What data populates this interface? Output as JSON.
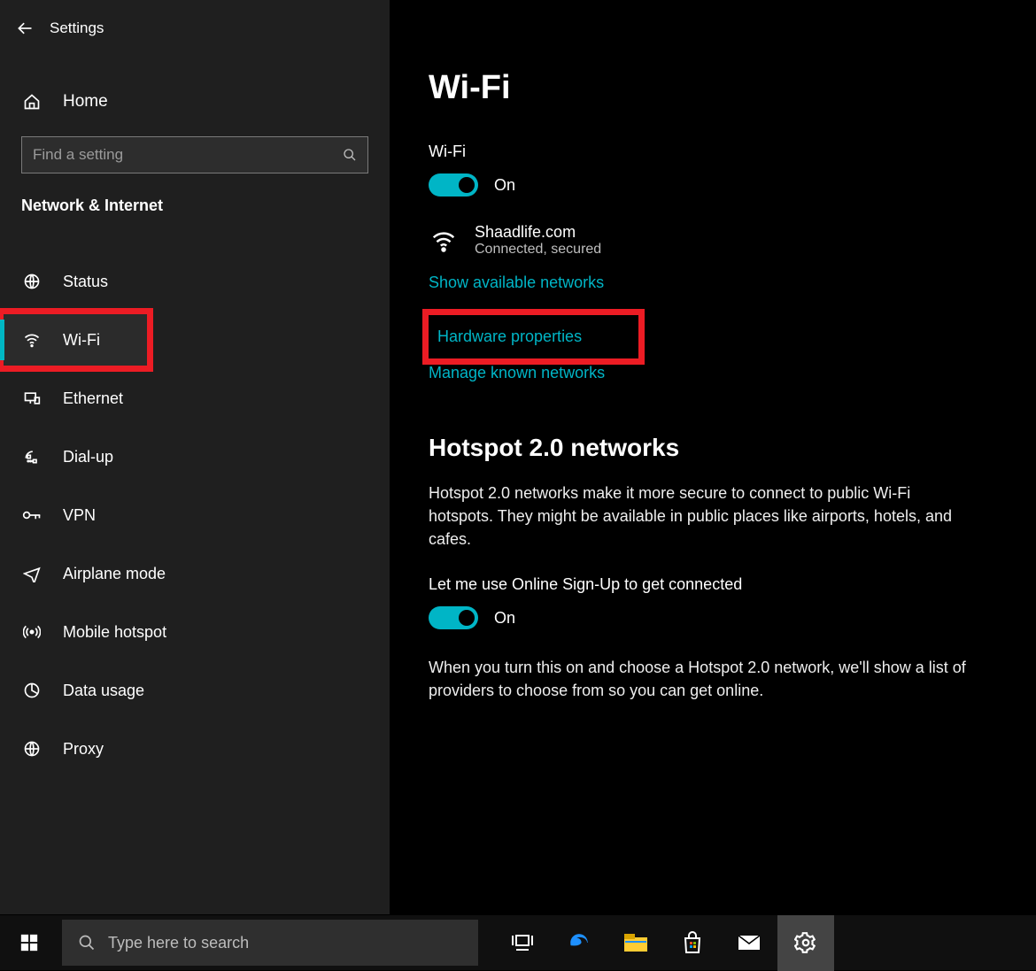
{
  "titlebar": {
    "title": "Settings"
  },
  "home": {
    "label": "Home"
  },
  "search": {
    "placeholder": "Find a setting"
  },
  "section": {
    "label": "Network & Internet"
  },
  "nav": {
    "items": [
      {
        "label": "Status",
        "icon": "globe-icon"
      },
      {
        "label": "Wi-Fi",
        "icon": "wifi-icon"
      },
      {
        "label": "Ethernet",
        "icon": "ethernet-icon"
      },
      {
        "label": "Dial-up",
        "icon": "dialup-icon"
      },
      {
        "label": "VPN",
        "icon": "vpn-icon"
      },
      {
        "label": "Airplane mode",
        "icon": "airplane-icon"
      },
      {
        "label": "Mobile hotspot",
        "icon": "hotspot-icon"
      },
      {
        "label": "Data usage",
        "icon": "datausage-icon"
      },
      {
        "label": "Proxy",
        "icon": "proxy-icon"
      }
    ]
  },
  "main": {
    "title": "Wi-Fi",
    "wifi": {
      "label": "Wi-Fi",
      "state": "On",
      "ssid": "Shaadlife.com",
      "status": "Connected, secured"
    },
    "links": {
      "show_networks": "Show available networks",
      "hardware_props": "Hardware properties",
      "known_networks": "Manage known networks"
    },
    "hotspot": {
      "heading": "Hotspot 2.0 networks",
      "desc": "Hotspot 2.0 networks make it more secure to connect to public Wi-Fi hotspots. They might be available in public places like airports, hotels, and cafes.",
      "signup_label": "Let me use Online Sign-Up to get connected",
      "state": "On",
      "note": "When you turn this on and choose a Hotspot 2.0 network, we'll show a list of providers to choose from so you can get online."
    }
  },
  "taskbar": {
    "search_placeholder": "Type here to search"
  }
}
